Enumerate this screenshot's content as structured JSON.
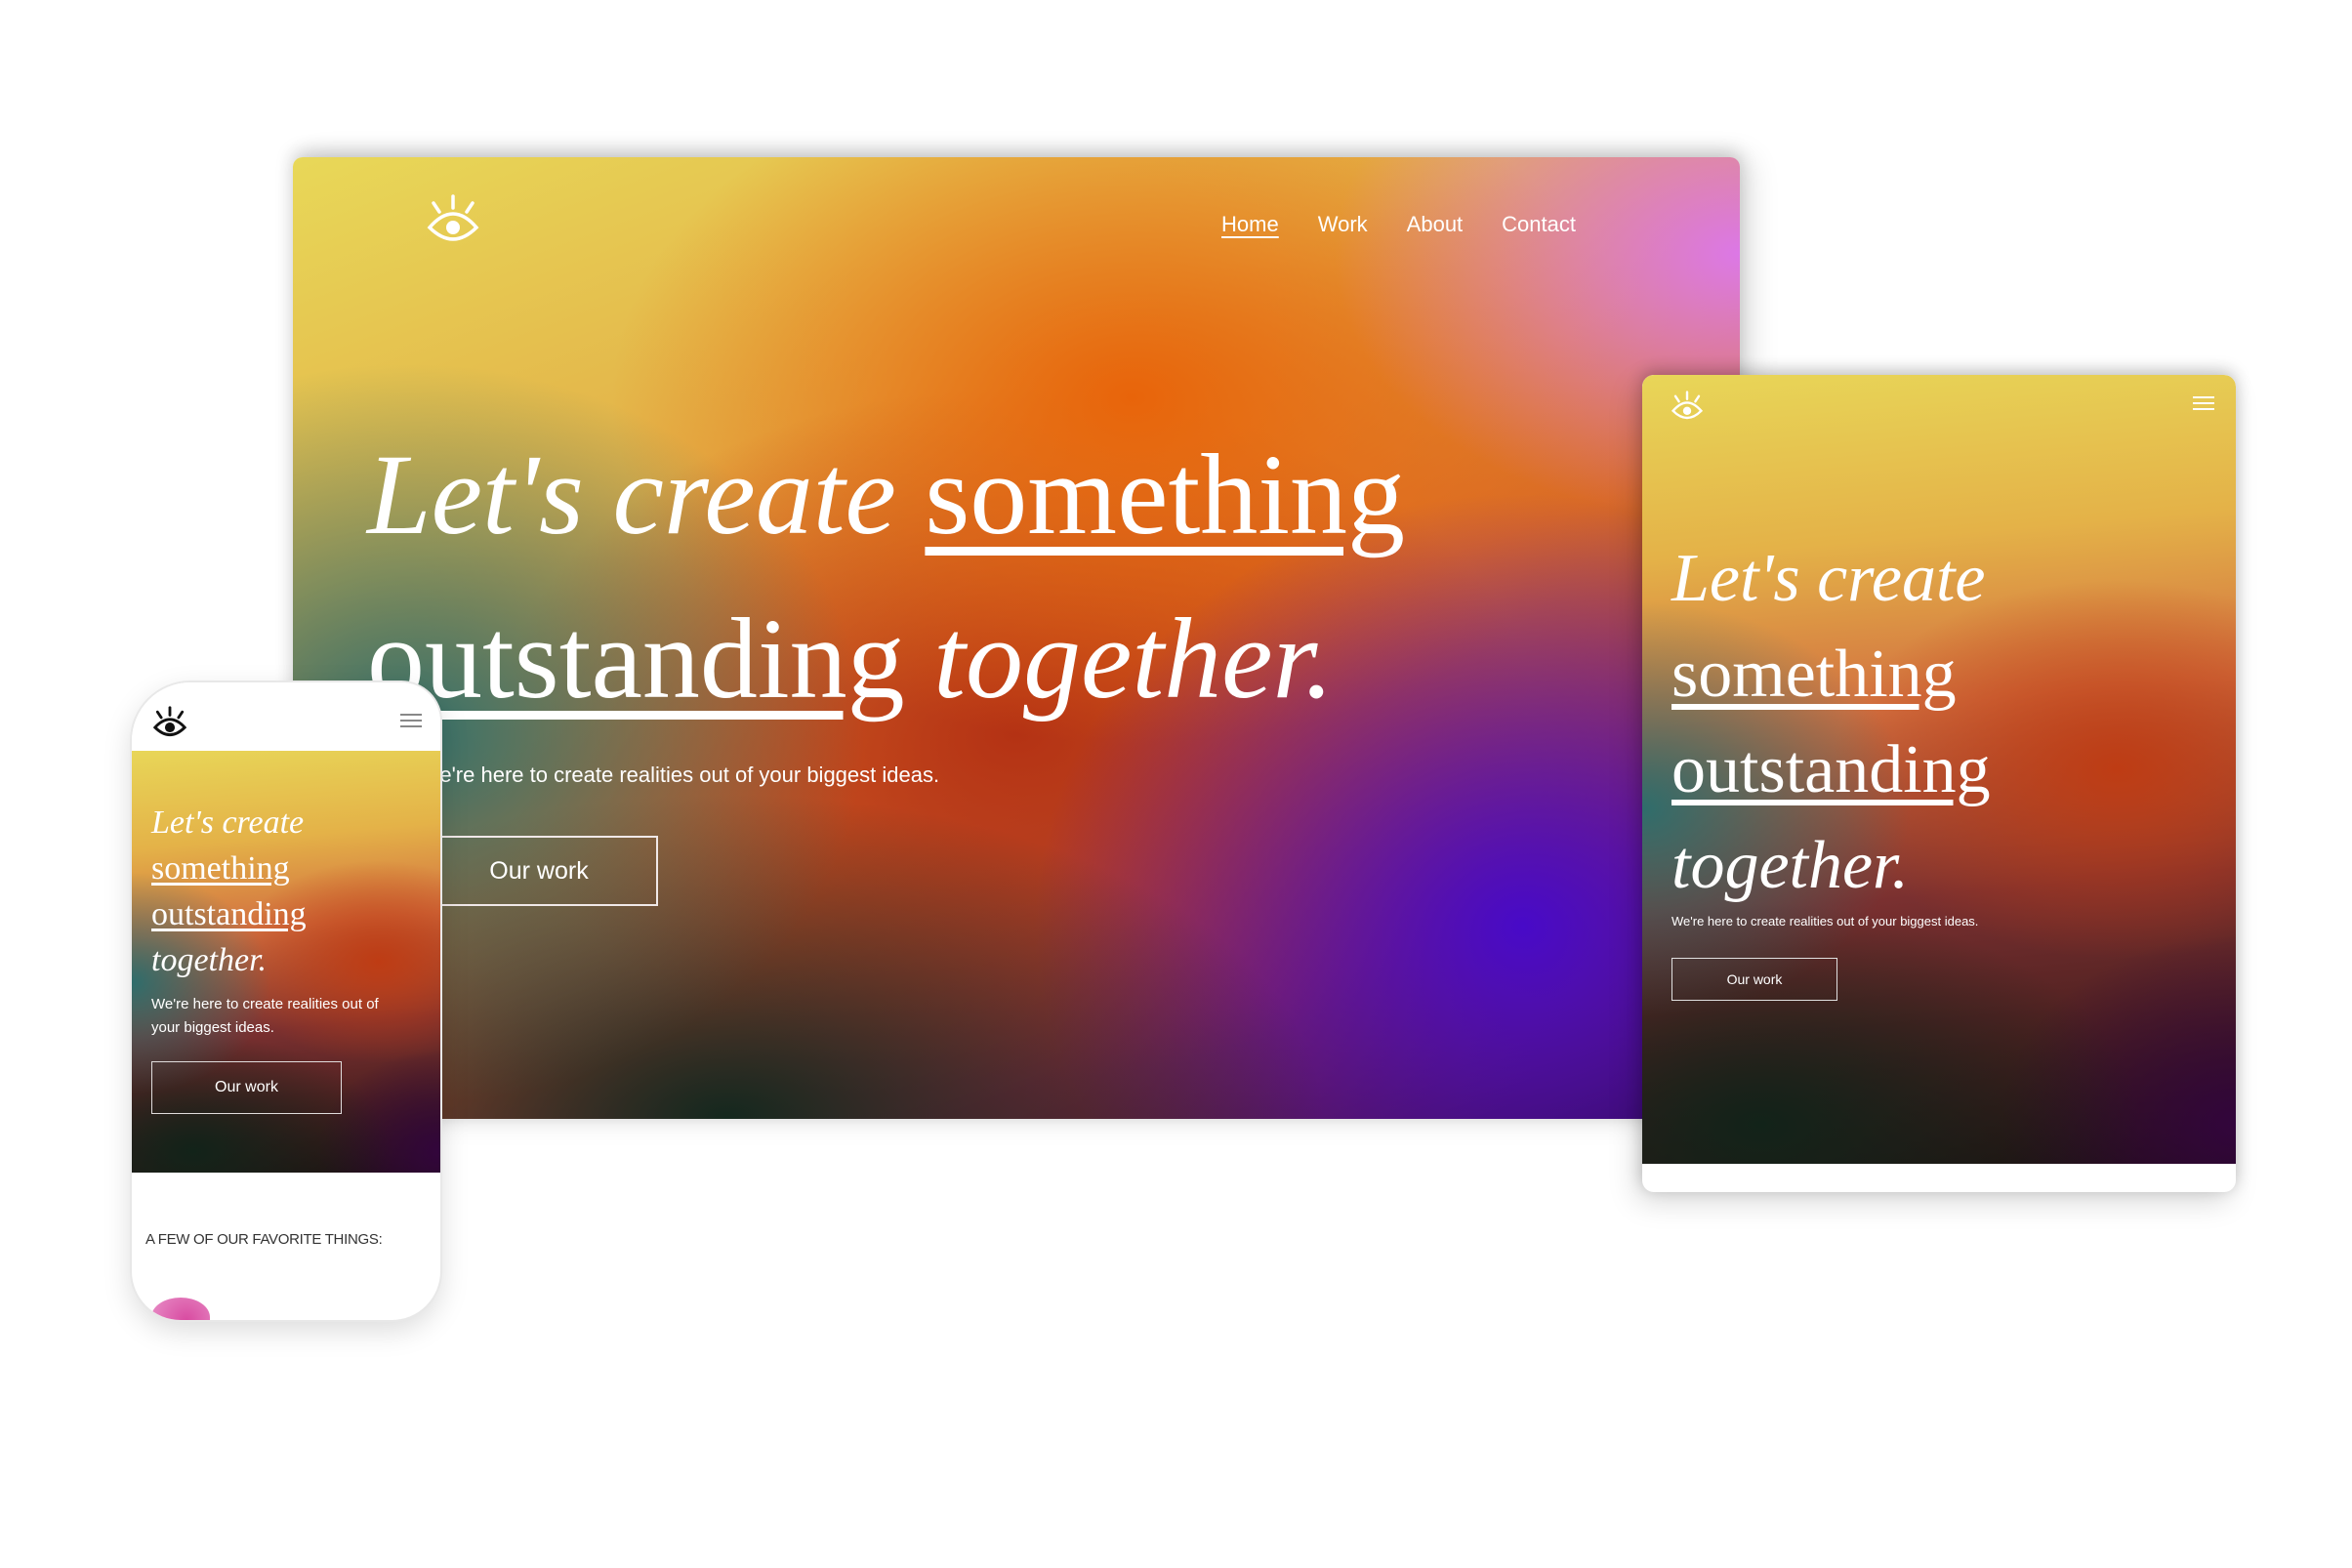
{
  "brand": {
    "logo": "eye-icon"
  },
  "desktop": {
    "nav": [
      {
        "label": "Home",
        "active": true
      },
      {
        "label": "Work",
        "active": false
      },
      {
        "label": "About",
        "active": false
      },
      {
        "label": "Contact",
        "active": false
      }
    ],
    "headline": {
      "part1": "Let's create ",
      "part2": "something",
      "part3": "outstanding",
      "part4": " together."
    },
    "subtitle": "We're here to create realities out of your biggest ideas.",
    "cta": "Our work"
  },
  "tablet": {
    "menu_icon": "hamburger-icon",
    "headline": {
      "part1": "Let's create",
      "part2": "something",
      "part3": "outstanding",
      "part4": "together."
    },
    "subtitle": "We're here to create realities out of your biggest ideas.",
    "cta": "Our work"
  },
  "phone": {
    "menu_icon": "hamburger-icon",
    "headline": {
      "part1": "Let's create",
      "part2": "something",
      "part3": "outstanding",
      "part4": "together."
    },
    "subtitle": "We're here to create realities out of your biggest ideas.",
    "cta": "Our work",
    "section_title": "A FEW OF OUR FAVORITE THINGS:"
  },
  "colors": {
    "text": "#ffffff",
    "gradient_yellow": "#e8d858",
    "gradient_orange": "#e8640a",
    "gradient_violet": "#4a0ac8",
    "gradient_teal": "#286e6e"
  }
}
